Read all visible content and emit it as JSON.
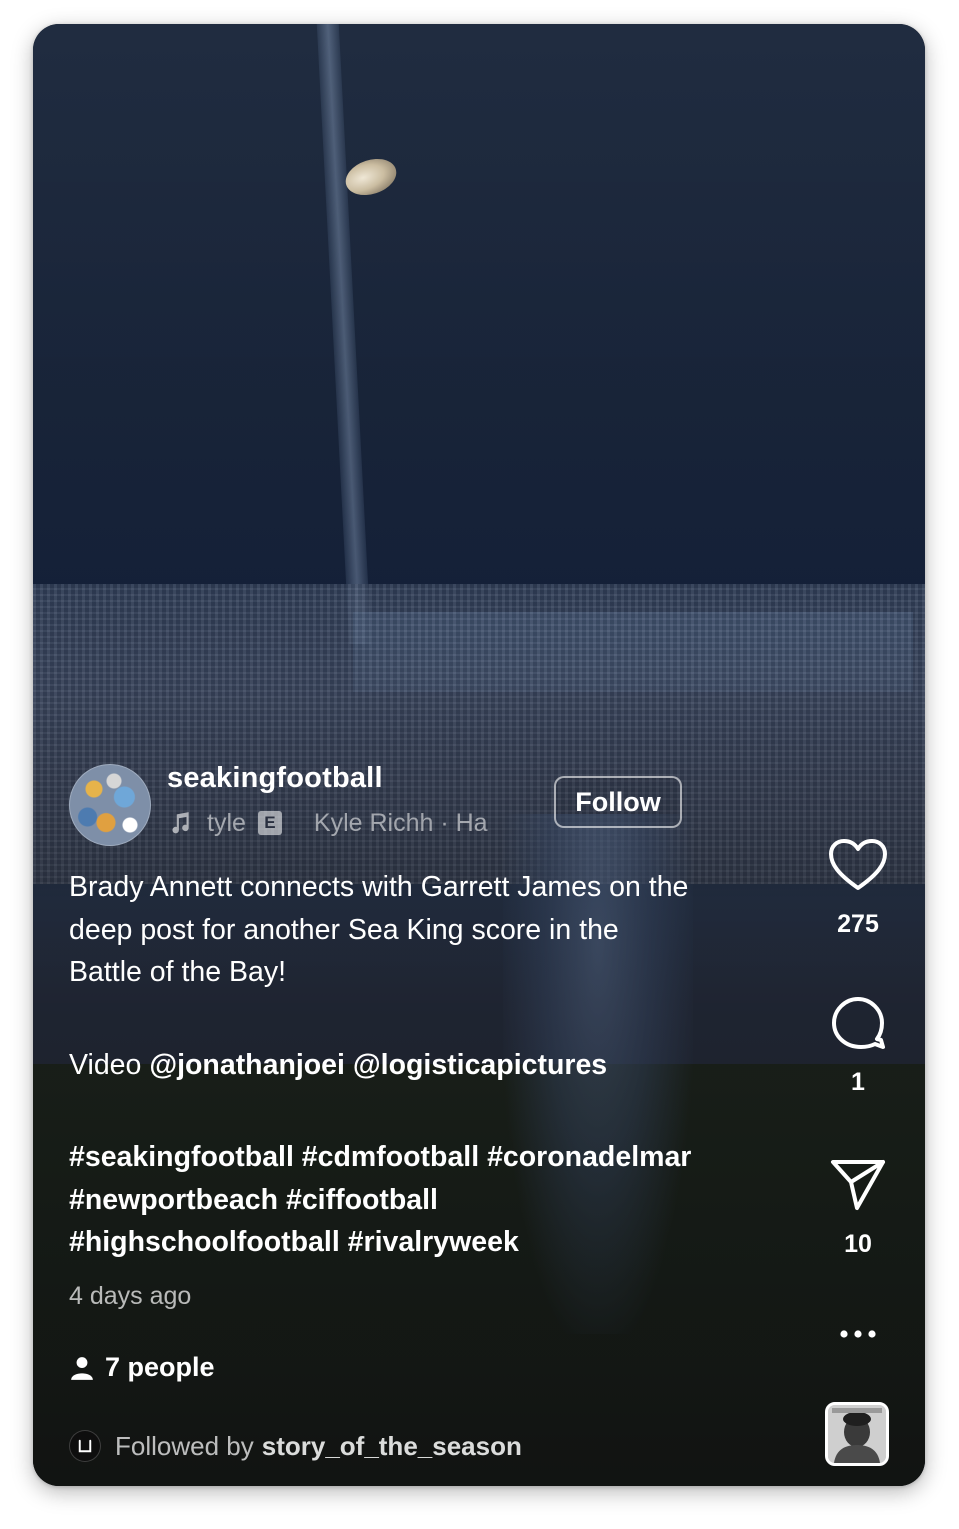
{
  "post": {
    "username": "seakingfootball",
    "follow_label": "Follow",
    "audio": {
      "title": "tyle",
      "explicit_badge": "E",
      "track": "Kyle Richh · Ha"
    },
    "caption": {
      "line1": "Brady Annett connects with Garrett James on the",
      "line2": "deep post for another Sea King score in the",
      "line3": "Battle of the Bay!",
      "video_prefix": "Video",
      "mention1": "@jonathanjoei",
      "mention2": "@logisticapictures",
      "hashtags_line1": "#seakingfootball #cdmfootball #coronadelmar",
      "hashtags_line2": "#newportbeach #ciffootball",
      "hashtags_line3": "#highschoolfootball #rivalryweek"
    },
    "time_ago": "4 days ago",
    "people_tagged": "7 people",
    "followed_by_prefix": "Followed by",
    "followed_by_name": "story_of_the_season"
  },
  "actions": {
    "likes": "275",
    "comments": "1",
    "shares": "10"
  },
  "icons": {
    "like": "heart-icon",
    "comment": "comment-bubble-icon",
    "share": "paper-plane-icon",
    "more": "more-dots-icon",
    "music": "music-note-icon",
    "people": "person-icon",
    "threads": "threads-logo-icon"
  },
  "colors": {
    "text": "#ffffff",
    "muted_text": "rgba(255,255,255,0.7)"
  }
}
